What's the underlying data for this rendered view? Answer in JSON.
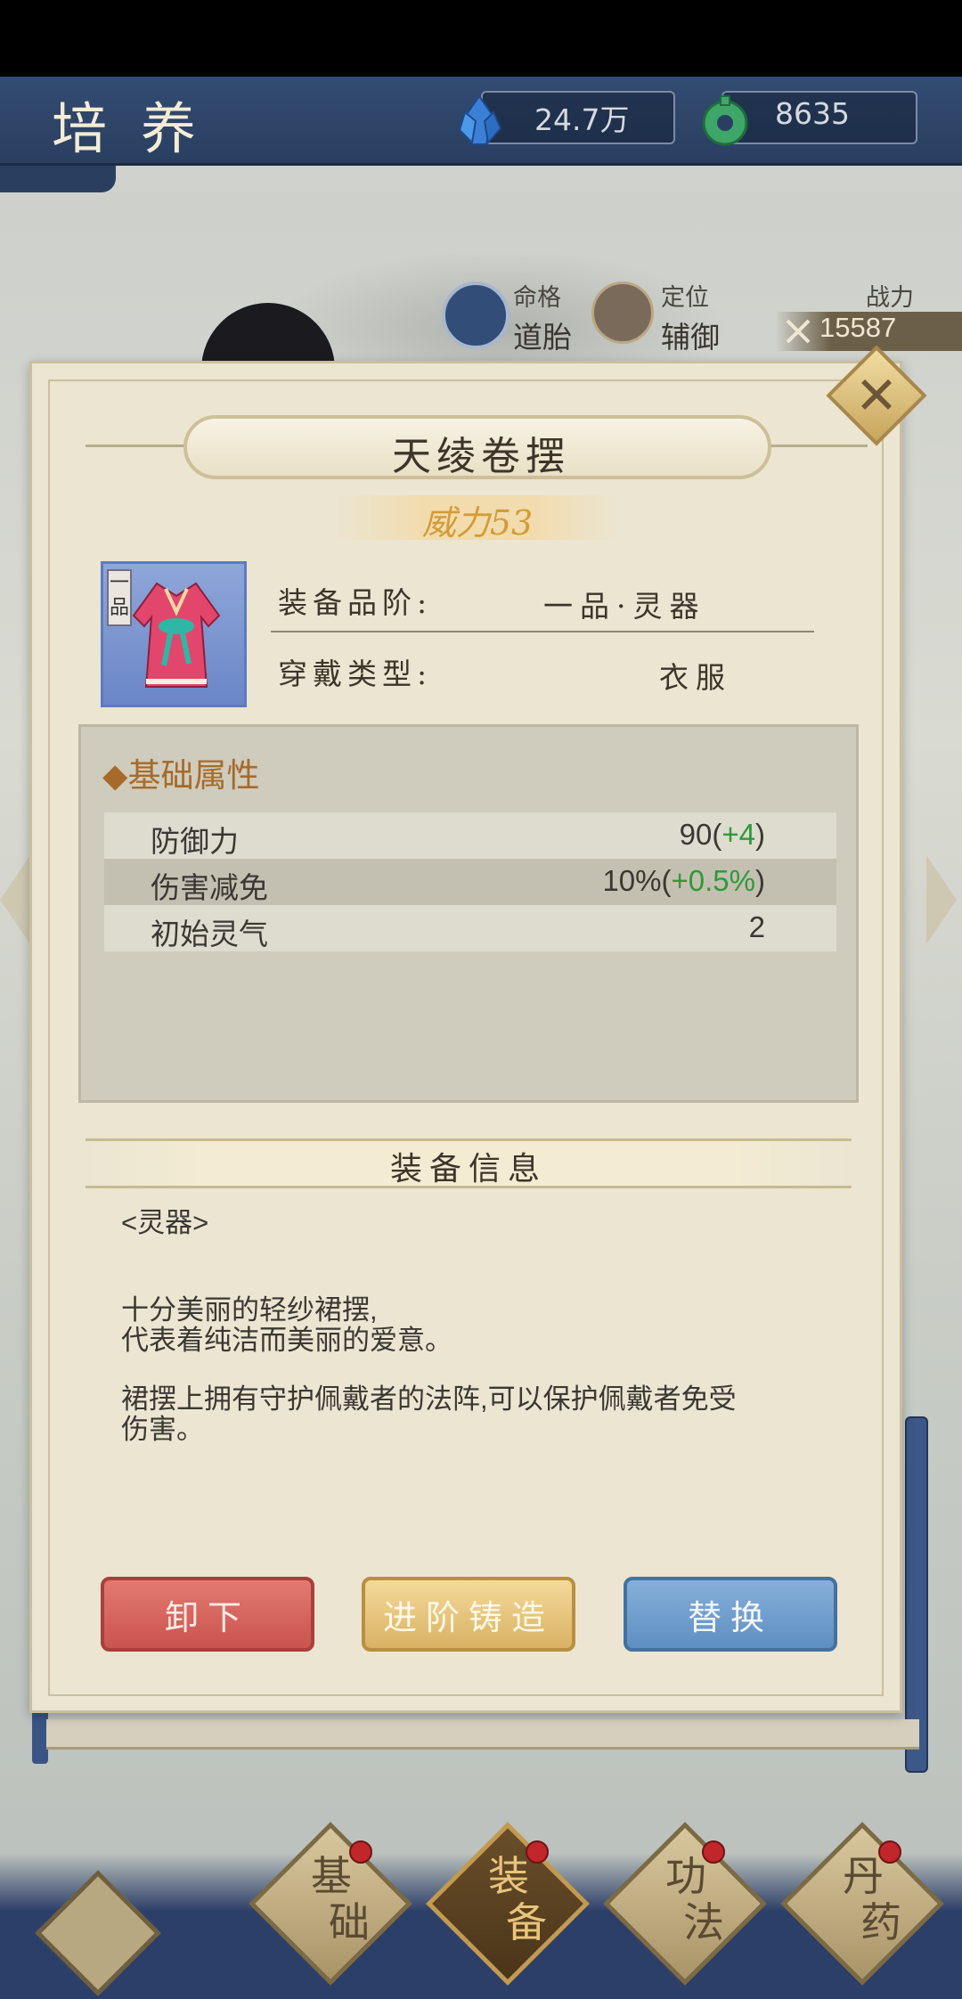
{
  "header": {
    "title": "培养",
    "currencies": [
      {
        "icon": "crystal-icon",
        "value": "24.7万"
      },
      {
        "icon": "jade-icon",
        "value": "8635"
      }
    ]
  },
  "stats": {
    "mingge_label": "命格",
    "mingge_value": "道胎",
    "dingwei_label": "定位",
    "dingwei_value": "辅御",
    "power_label": "战力",
    "power_value": "15587"
  },
  "item": {
    "name": "天绫卷摆",
    "power": "威力53",
    "grade_tag": "一品",
    "grade_label": "装备品阶:",
    "grade_value": "一品·灵器",
    "type_label": "穿戴类型:",
    "type_value": "衣服"
  },
  "attributes": {
    "title": "◆基础属性",
    "rows": [
      {
        "name": "防御力",
        "value": "90",
        "bonus": "+4"
      },
      {
        "name": "伤害减免",
        "value": "10%",
        "bonus": "+0.5%"
      },
      {
        "name": "初始灵气",
        "value": "2",
        "bonus": ""
      }
    ]
  },
  "info": {
    "title": "装备信息",
    "category": "<灵器>",
    "desc1_line1": "十分美丽的轻纱裙摆,",
    "desc1_line2": "代表着纯洁而美丽的爱意。",
    "desc2_line1": "裙摆上拥有守护佩戴者的法阵,可以保护佩戴者免受",
    "desc2_line2": "伤害。"
  },
  "buttons": {
    "unequip": "卸下",
    "upgrade": "进阶铸造",
    "replace": "替换"
  },
  "nav": {
    "tabs": [
      {
        "top": "基",
        "bottom": "础"
      },
      {
        "top": "装",
        "bottom": "备"
      },
      {
        "top": "功",
        "bottom": "法"
      },
      {
        "top": "丹",
        "bottom": "药"
      }
    ]
  },
  "colors": {
    "header_bg": "#2a3f60",
    "panel_bg": "#ebe5d2",
    "power_text": "#d49b36",
    "bonus_text": "#2e9a3a",
    "attr_title": "#a66b2a"
  }
}
